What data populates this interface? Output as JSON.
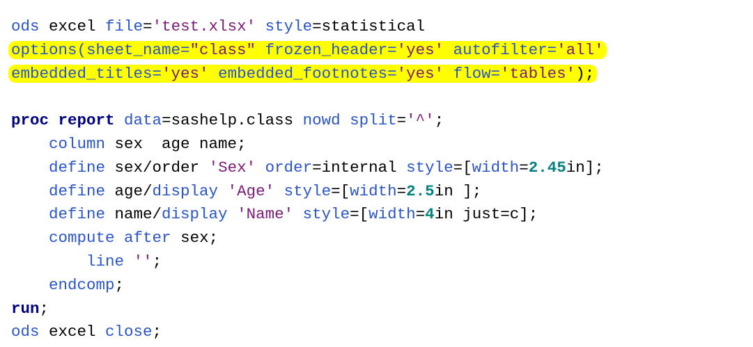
{
  "code_lines": [
    {
      "indent": "",
      "highlight": false,
      "tokens": [
        {
          "t": "ods",
          "c": "kw"
        },
        {
          "t": " excel ",
          "c": "plain"
        },
        {
          "t": "file",
          "c": "kw"
        },
        {
          "t": "=",
          "c": "plain"
        },
        {
          "t": "'test.xlsx'",
          "c": "str"
        },
        {
          "t": " ",
          "c": "plain"
        },
        {
          "t": "style",
          "c": "kw"
        },
        {
          "t": "=statistical",
          "c": "plain"
        }
      ]
    },
    {
      "indent": "",
      "highlight": true,
      "tokens": [
        {
          "t": "options(sheet_name=",
          "c": "kw"
        },
        {
          "t": "\"class\"",
          "c": "str"
        },
        {
          "t": " ",
          "c": "plain"
        },
        {
          "t": "frozen_header=",
          "c": "kw"
        },
        {
          "t": "'yes'",
          "c": "str"
        },
        {
          "t": " ",
          "c": "plain"
        },
        {
          "t": "autofilter=",
          "c": "kw"
        },
        {
          "t": "'all'",
          "c": "str"
        }
      ]
    },
    {
      "indent": "",
      "highlight": true,
      "tokens": [
        {
          "t": "embedded_titles=",
          "c": "kw"
        },
        {
          "t": "'yes'",
          "c": "str"
        },
        {
          "t": " ",
          "c": "plain"
        },
        {
          "t": "embedded_footnotes=",
          "c": "kw"
        },
        {
          "t": "'yes'",
          "c": "str"
        },
        {
          "t": " ",
          "c": "plain"
        },
        {
          "t": "flow=",
          "c": "kw"
        },
        {
          "t": "'tables'",
          "c": "str"
        },
        {
          "t": ");",
          "c": "plain"
        }
      ]
    },
    {
      "indent": "",
      "highlight": false,
      "tokens": []
    },
    {
      "indent": "",
      "highlight": false,
      "tokens": [
        {
          "t": "proc report",
          "c": "bold"
        },
        {
          "t": " ",
          "c": "plain"
        },
        {
          "t": "data",
          "c": "kw"
        },
        {
          "t": "=sashelp.class ",
          "c": "plain"
        },
        {
          "t": "nowd",
          "c": "kw"
        },
        {
          "t": " ",
          "c": "plain"
        },
        {
          "t": "split",
          "c": "kw"
        },
        {
          "t": "=",
          "c": "plain"
        },
        {
          "t": "'^'",
          "c": "str"
        },
        {
          "t": ";",
          "c": "plain"
        }
      ]
    },
    {
      "indent": "    ",
      "highlight": false,
      "tokens": [
        {
          "t": "column",
          "c": "kw"
        },
        {
          "t": " sex  age name;",
          "c": "plain"
        }
      ]
    },
    {
      "indent": "    ",
      "highlight": false,
      "tokens": [
        {
          "t": "define",
          "c": "kw"
        },
        {
          "t": " sex/order ",
          "c": "plain"
        },
        {
          "t": "'Sex'",
          "c": "str"
        },
        {
          "t": " ",
          "c": "plain"
        },
        {
          "t": "order",
          "c": "kw"
        },
        {
          "t": "=internal ",
          "c": "plain"
        },
        {
          "t": "style",
          "c": "kw"
        },
        {
          "t": "=[",
          "c": "plain"
        },
        {
          "t": "width",
          "c": "kw"
        },
        {
          "t": "=",
          "c": "plain"
        },
        {
          "t": "2.45",
          "c": "num"
        },
        {
          "t": "in];",
          "c": "plain"
        }
      ]
    },
    {
      "indent": "    ",
      "highlight": false,
      "tokens": [
        {
          "t": "define",
          "c": "kw"
        },
        {
          "t": " age/",
          "c": "plain"
        },
        {
          "t": "display",
          "c": "kw"
        },
        {
          "t": " ",
          "c": "plain"
        },
        {
          "t": "'Age'",
          "c": "str"
        },
        {
          "t": " ",
          "c": "plain"
        },
        {
          "t": "style",
          "c": "kw"
        },
        {
          "t": "=[",
          "c": "plain"
        },
        {
          "t": "width",
          "c": "kw"
        },
        {
          "t": "=",
          "c": "plain"
        },
        {
          "t": "2.5",
          "c": "num"
        },
        {
          "t": "in ];",
          "c": "plain"
        }
      ]
    },
    {
      "indent": "    ",
      "highlight": false,
      "tokens": [
        {
          "t": "define",
          "c": "kw"
        },
        {
          "t": " name/",
          "c": "plain"
        },
        {
          "t": "display",
          "c": "kw"
        },
        {
          "t": " ",
          "c": "plain"
        },
        {
          "t": "'Name'",
          "c": "str"
        },
        {
          "t": " ",
          "c": "plain"
        },
        {
          "t": "style",
          "c": "kw"
        },
        {
          "t": "=[",
          "c": "plain"
        },
        {
          "t": "width",
          "c": "kw"
        },
        {
          "t": "=",
          "c": "plain"
        },
        {
          "t": "4",
          "c": "num"
        },
        {
          "t": "in just=c];",
          "c": "plain"
        }
      ]
    },
    {
      "indent": "    ",
      "highlight": false,
      "tokens": [
        {
          "t": "compute",
          "c": "kw"
        },
        {
          "t": " ",
          "c": "plain"
        },
        {
          "t": "after",
          "c": "kw"
        },
        {
          "t": " sex;",
          "c": "plain"
        }
      ]
    },
    {
      "indent": "        ",
      "highlight": false,
      "tokens": [
        {
          "t": "line",
          "c": "kw"
        },
        {
          "t": " ",
          "c": "plain"
        },
        {
          "t": "''",
          "c": "str"
        },
        {
          "t": ";",
          "c": "plain"
        }
      ]
    },
    {
      "indent": "    ",
      "highlight": false,
      "tokens": [
        {
          "t": "endcomp",
          "c": "kw"
        },
        {
          "t": ";",
          "c": "plain"
        }
      ]
    },
    {
      "indent": "",
      "highlight": false,
      "tokens": [
        {
          "t": "run",
          "c": "bold"
        },
        {
          "t": ";",
          "c": "plain"
        }
      ]
    },
    {
      "indent": "",
      "highlight": false,
      "tokens": [
        {
          "t": "ods",
          "c": "kw"
        },
        {
          "t": " excel ",
          "c": "plain"
        },
        {
          "t": "close",
          "c": "kw"
        },
        {
          "t": ";",
          "c": "plain"
        }
      ]
    }
  ],
  "colors": {
    "keyword": "#2a55c6",
    "string": "#7b1a78",
    "number": "#008080",
    "bold_keyword": "#000080",
    "highlight": "#ffff00"
  }
}
